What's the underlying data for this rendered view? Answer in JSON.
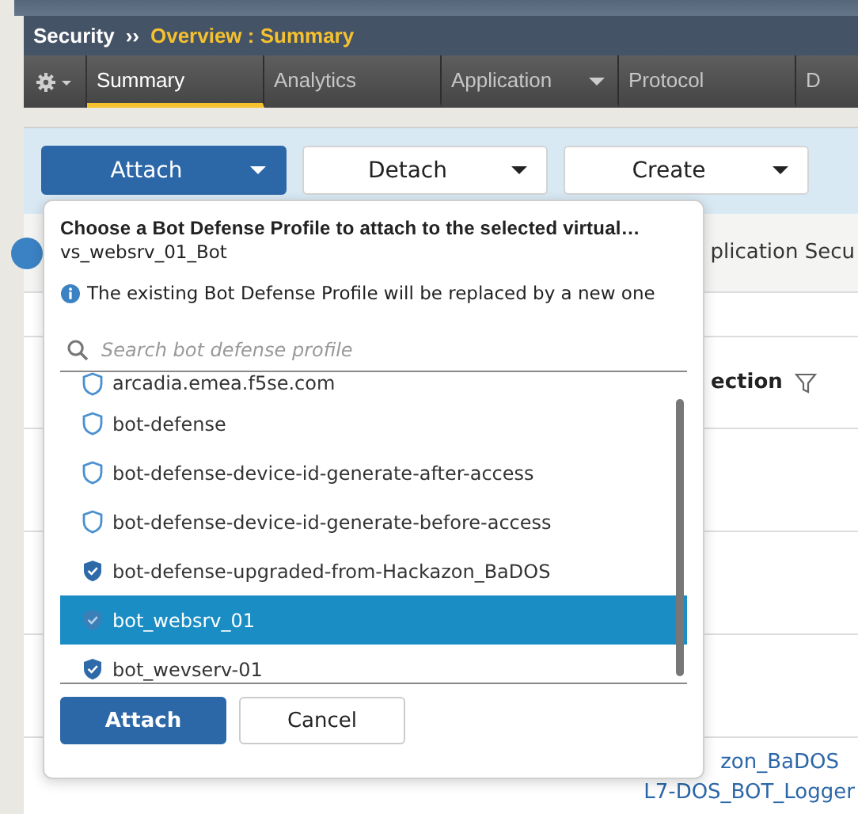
{
  "breadcrumb": {
    "section": "Security",
    "separator": "››",
    "page": "Overview : Summary"
  },
  "tabs": [
    {
      "label": "Summary",
      "selected": true,
      "dropdown": false
    },
    {
      "label": "Analytics",
      "selected": false,
      "dropdown": false
    },
    {
      "label": "Application",
      "selected": false,
      "dropdown": true
    },
    {
      "label": "Protocol",
      "selected": false,
      "dropdown": false
    },
    {
      "label": "D",
      "selected": false,
      "dropdown": false
    }
  ],
  "toolbar": [
    {
      "label": "Attach",
      "selected": true
    },
    {
      "label": "Detach",
      "selected": false
    },
    {
      "label": "Create",
      "selected": false
    }
  ],
  "background": {
    "section_title": "plication Secu",
    "column_header": "ection",
    "links": [
      "zon_BaDOS",
      "L7-DOS_BOT_Logger"
    ]
  },
  "dialog": {
    "title": "Choose a Bot Defense Profile to attach to the selected virtual…",
    "subtitle": "vs_websrv_01_Bot",
    "info": "The existing Bot Defense Profile will be replaced by a new one",
    "search": {
      "placeholder": "Search bot defense profile"
    },
    "profiles": [
      {
        "name": "arcadia.emea.f5se.com",
        "kind": "default",
        "selected": false
      },
      {
        "name": "bot-defense",
        "kind": "default",
        "selected": false
      },
      {
        "name": "bot-defense-device-id-generate-after-access",
        "kind": "default",
        "selected": false
      },
      {
        "name": "bot-defense-device-id-generate-before-access",
        "kind": "default",
        "selected": false
      },
      {
        "name": "bot-defense-upgraded-from-Hackazon_BaDOS",
        "kind": "custom",
        "selected": false
      },
      {
        "name": "bot_websrv_01",
        "kind": "custom",
        "selected": true
      },
      {
        "name": "bot_wevserv-01",
        "kind": "custom",
        "selected": false
      }
    ],
    "buttons": [
      {
        "label": "Attach",
        "kind": "primary"
      },
      {
        "label": "Cancel",
        "kind": "secondary"
      }
    ]
  }
}
